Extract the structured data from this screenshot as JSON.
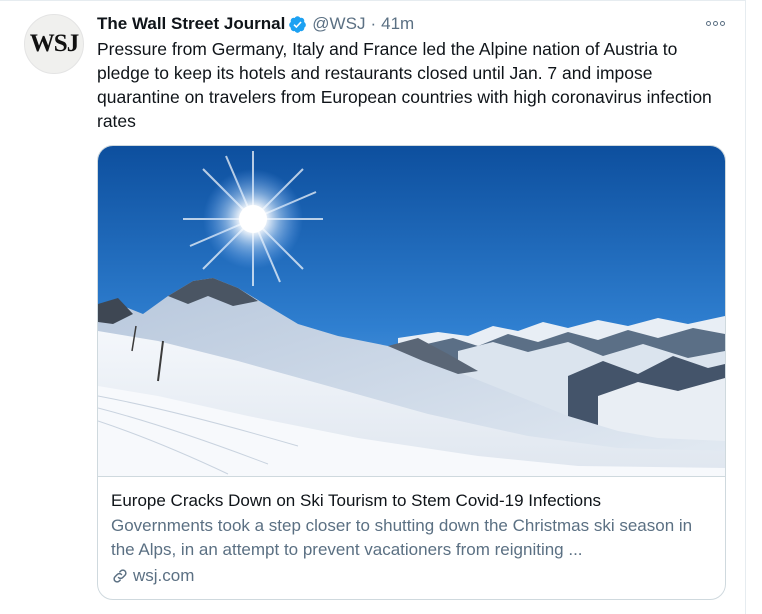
{
  "tweet": {
    "author": {
      "avatar_text": "WSJ",
      "display_name": "The Wall Street Journal",
      "verified_icon": "verified-badge-icon",
      "handle": "@WSJ",
      "separator": "·",
      "time": "41m"
    },
    "text": "Pressure from Germany, Italy and France led the Alpine nation of Austria to pledge to keep its hotels and restaurants closed until Jan. 7 and impose quarantine on travelers from European countries with high coronavirus infection rates",
    "card": {
      "title": "Europe Cracks Down on Ski Tourism to Stem Covid-19 Infections",
      "description": "Governments took a step closer to shutting down the Christmas ski season in the Alps, in an attempt to prevent vacationers from reigniting ...",
      "domain": "wsj.com",
      "image_description": "snowy alpine ski slope under bright sun"
    }
  },
  "colors": {
    "verified": "#1da1f2",
    "secondary_text": "#5b7083",
    "border": "#cfd9de"
  }
}
